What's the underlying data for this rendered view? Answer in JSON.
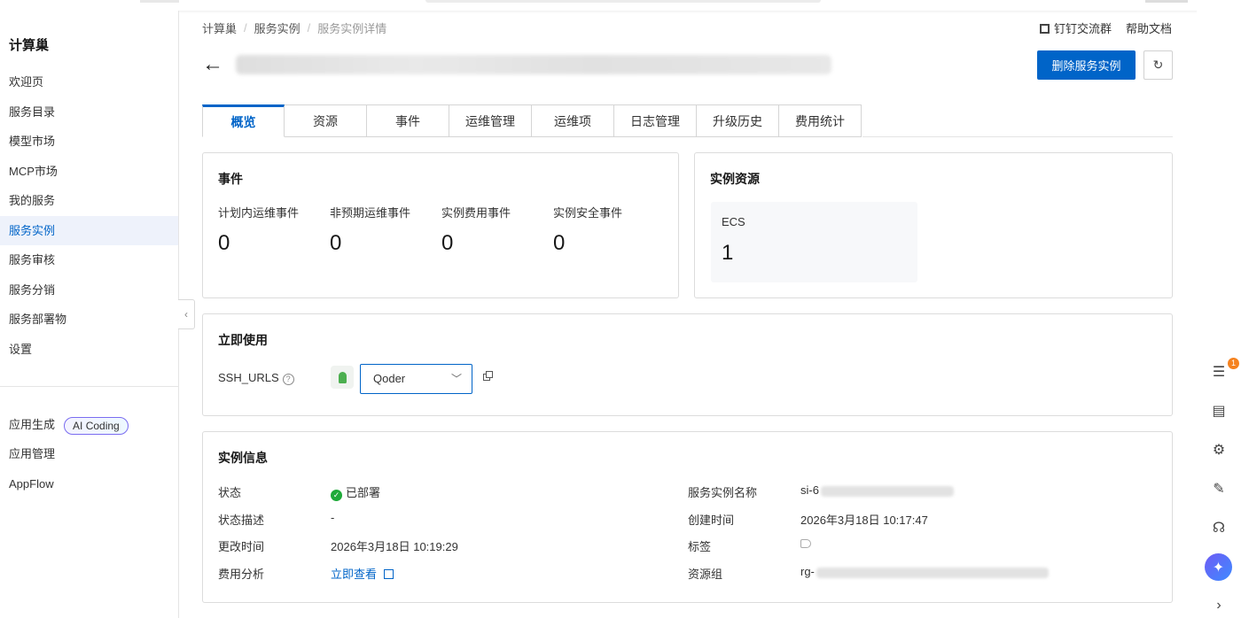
{
  "sidebar": {
    "title": "计算巢",
    "items": [
      {
        "label": "欢迎页"
      },
      {
        "label": "服务目录"
      },
      {
        "label": "模型市场"
      },
      {
        "label": "MCP市场"
      },
      {
        "label": "我的服务"
      },
      {
        "label": "服务实例",
        "active": true
      },
      {
        "label": "服务审核"
      },
      {
        "label": "服务分销"
      },
      {
        "label": "服务部署物"
      },
      {
        "label": "设置"
      }
    ],
    "bottom_items": [
      {
        "label": "应用生成",
        "badge": "AI Coding"
      },
      {
        "label": "应用管理"
      },
      {
        "label": "AppFlow"
      }
    ]
  },
  "breadcrumb": [
    "计算巢",
    "服务实例",
    "服务实例详情"
  ],
  "top_links": {
    "dingtalk": "钉钉交流群",
    "help": "帮助文档"
  },
  "header": {
    "delete_button": "删除服务实例"
  },
  "tabs": [
    "概览",
    "资源",
    "事件",
    "运维管理",
    "运维项",
    "日志管理",
    "升级历史",
    "费用统计"
  ],
  "events_card": {
    "title": "事件",
    "stats": [
      {
        "label": "计划内运维事件",
        "value": "0"
      },
      {
        "label": "非预期运维事件",
        "value": "0"
      },
      {
        "label": "实例费用事件",
        "value": "0"
      },
      {
        "label": "实例安全事件",
        "value": "0"
      }
    ]
  },
  "resources_card": {
    "title": "实例资源",
    "ecs_label": "ECS",
    "ecs_value": "1"
  },
  "use_card": {
    "title": "立即使用",
    "ssh_label": "SSH_URLS",
    "help_glyph": "?",
    "select_value": "Qoder"
  },
  "info_card": {
    "title": "实例信息",
    "left": [
      {
        "label": "状态",
        "value": "已部署"
      },
      {
        "label": "状态描述",
        "value": "-"
      },
      {
        "label": "更改时间",
        "value": "2026年3月18日 10:19:29"
      },
      {
        "label": "费用分析",
        "value": "立即查看"
      }
    ],
    "right": [
      {
        "label": "服务实例名称",
        "value": "si-6"
      },
      {
        "label": "创建时间",
        "value": "2026年3月18日 10:17:47"
      },
      {
        "label": "标签",
        "value": ""
      },
      {
        "label": "资源组",
        "value": "rg-"
      }
    ]
  },
  "right_rail": {
    "notification_count": "1"
  },
  "colors": {
    "primary": "#0064c8",
    "success": "#1eaa39",
    "badge": "#f5821f"
  }
}
